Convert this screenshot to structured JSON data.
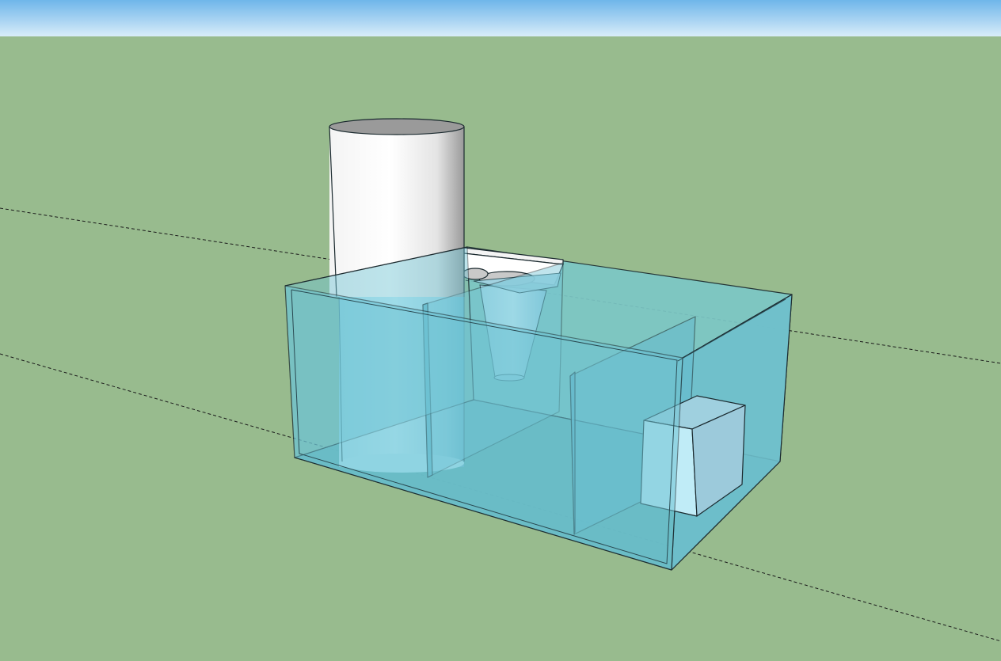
{
  "viewport": {
    "sky_color": "#a8d3f2",
    "ground_color": "#98bb8e"
  },
  "model": {
    "objects": [
      "glass-tank",
      "filter-sock-cylinder",
      "filter-tray",
      "cone-filter",
      "baffle-divider",
      "pump-box"
    ],
    "glass_color": "#6fc4d4",
    "edge_color": "#1b2a2f",
    "cylinder_color": "#ffffff",
    "pump_color": "#bfe8f3"
  },
  "axes": {
    "style": "dashed",
    "color": "#1a1a1a"
  }
}
